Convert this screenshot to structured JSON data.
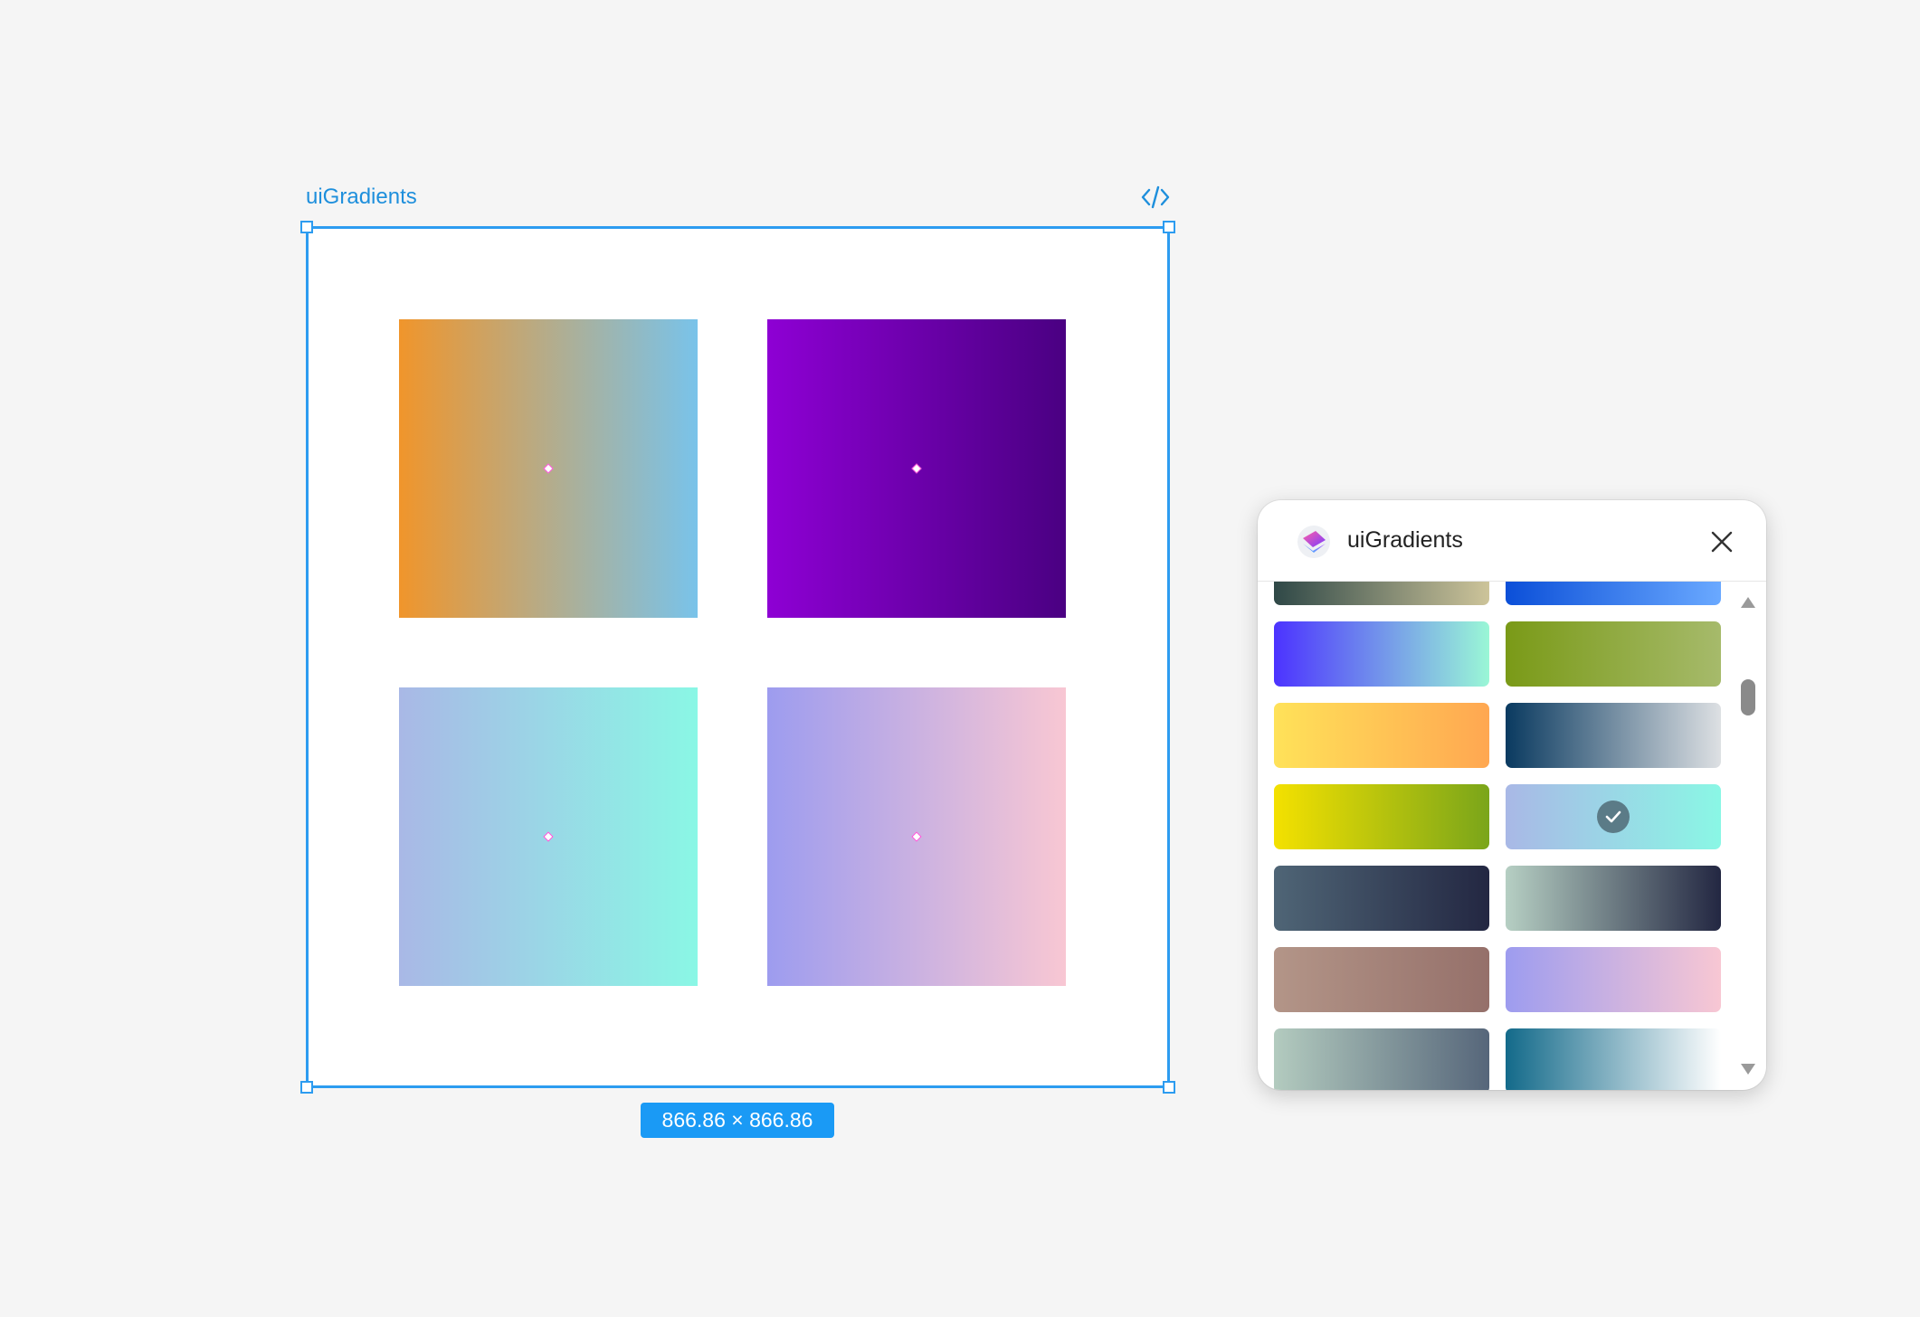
{
  "frame": {
    "label": "uiGradients",
    "size_badge": "866.86 × 866.86"
  },
  "tiles": [
    {
      "name": "tile-orange-blue",
      "from": "#f0952b",
      "to": "#79c3ea"
    },
    {
      "name": "tile-purple",
      "from": "#8e00d4",
      "to": "#4a0082"
    },
    {
      "name": "tile-lavender-mint",
      "from": "#a9b8e6",
      "to": "#8af7e5"
    },
    {
      "name": "tile-periwinkle-pink",
      "from": "#9d9cef",
      "to": "#f8c7d3"
    }
  ],
  "panel": {
    "title": "uiGradients",
    "icons": {
      "logo": "uigradients-logo-icon",
      "close": "close-icon",
      "up": "scroll-up-icon",
      "down": "scroll-down-icon"
    },
    "selected_index": 7,
    "swatches": [
      {
        "from": "#2f4847",
        "to": "#cdc49a"
      },
      {
        "from": "#0b4fd8",
        "to": "#6aa9ff"
      },
      {
        "from": "#4c33ff",
        "to": "#9af7d6"
      },
      {
        "from": "#7a9a17",
        "to": "#a6ba6b"
      },
      {
        "from": "#ffe259",
        "to": "#ffa751"
      },
      {
        "from": "#0a3a60",
        "to": "#dde0e3"
      },
      {
        "from": "#f4e100",
        "to": "#7aa51a"
      },
      {
        "from": "#a9b8e6",
        "to": "#8af7e5"
      },
      {
        "from": "#4f6576",
        "to": "#232742"
      },
      {
        "from": "#b6cfc3",
        "to": "#232742"
      },
      {
        "from": "#b39588",
        "to": "#95706a"
      },
      {
        "from": "#9d9cef",
        "to": "#f8c7d3"
      },
      {
        "from": "#b3cbbf",
        "to": "#56667a"
      },
      {
        "from": "#136a8a",
        "to": "#ffffff"
      }
    ]
  }
}
